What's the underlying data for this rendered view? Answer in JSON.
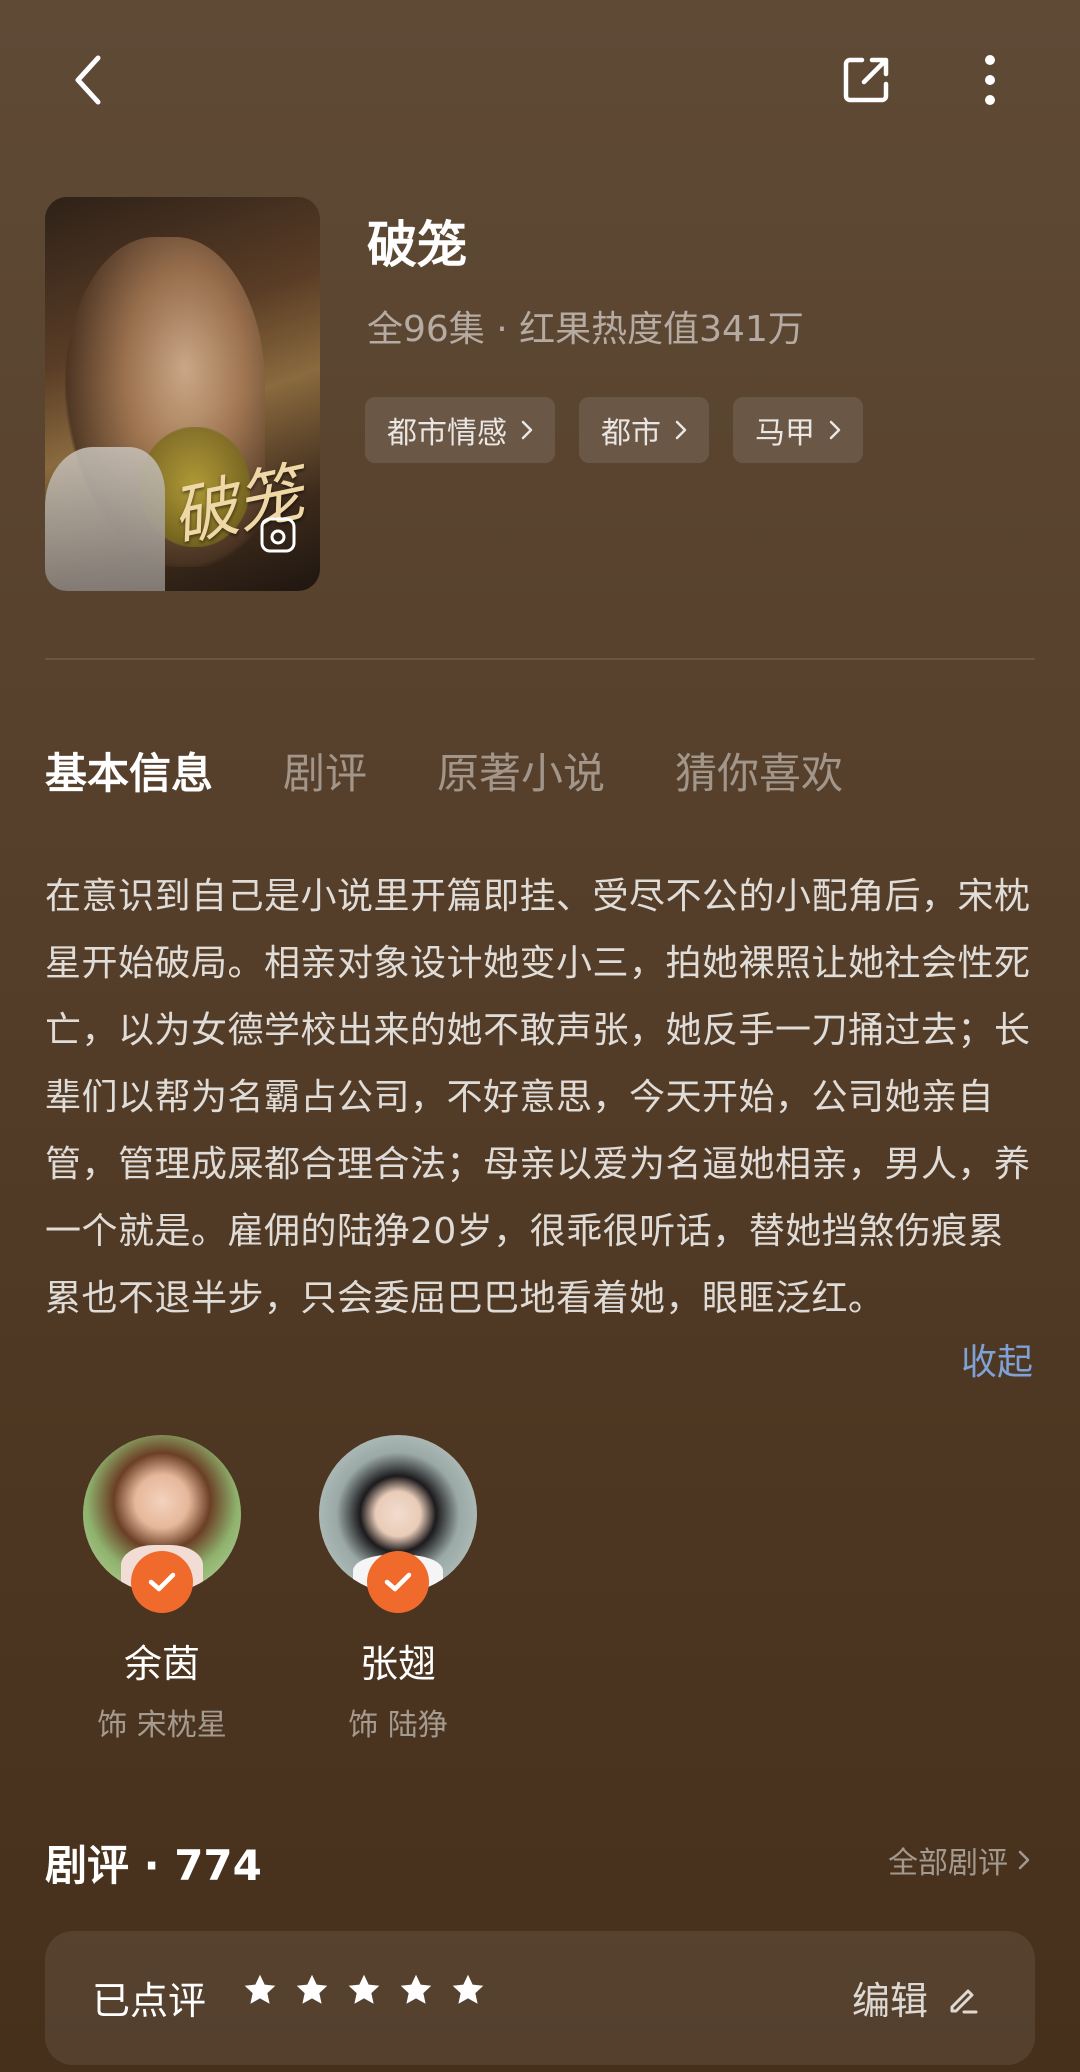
{
  "header": {
    "back_icon": "chevron-left-icon",
    "share_icon": "share-external-icon",
    "more_icon": "more-vertical-icon"
  },
  "poster": {
    "title_art": "破笼"
  },
  "drama": {
    "title": "破笼",
    "meta": "全96集 · 红果热度值341万",
    "tags": [
      "都市情感",
      "都市",
      "马甲"
    ]
  },
  "tabs": [
    "基本信息",
    "剧评",
    "原著小说",
    "猜你喜欢"
  ],
  "synopsis": {
    "text": "在意识到自己是小说里开篇即挂、受尽不公的小配角后，宋枕星开始破局。相亲对象设计她变小三，拍她裸照让她社会性死亡，以为女德学校出来的她不敢声张，她反手一刀捅过去；长辈们以帮为名霸占公司，不好意思，今天开始，公司她亲自管，管理成屎都合理合法；母亲以爱为名逼她相亲，男人，养一个就是。雇佣的陆狰20岁，很乖很听话，替她挡煞伤痕累累也不退半步，只会委屈巴巴地看着她，眼眶泛红。",
    "collapse_label": "收起"
  },
  "cast": [
    {
      "name": "余茵",
      "role": "饰 宋枕星"
    },
    {
      "name": "张翅",
      "role": "饰 陆狰"
    }
  ],
  "reviews": {
    "title": "剧评 · 774",
    "all_label": "全部剧评",
    "rated_label": "已点评",
    "rating": 5,
    "edit_label": "编辑"
  },
  "colors": {
    "accent_badge": "#f06a2c",
    "link": "#7fa2d6"
  }
}
